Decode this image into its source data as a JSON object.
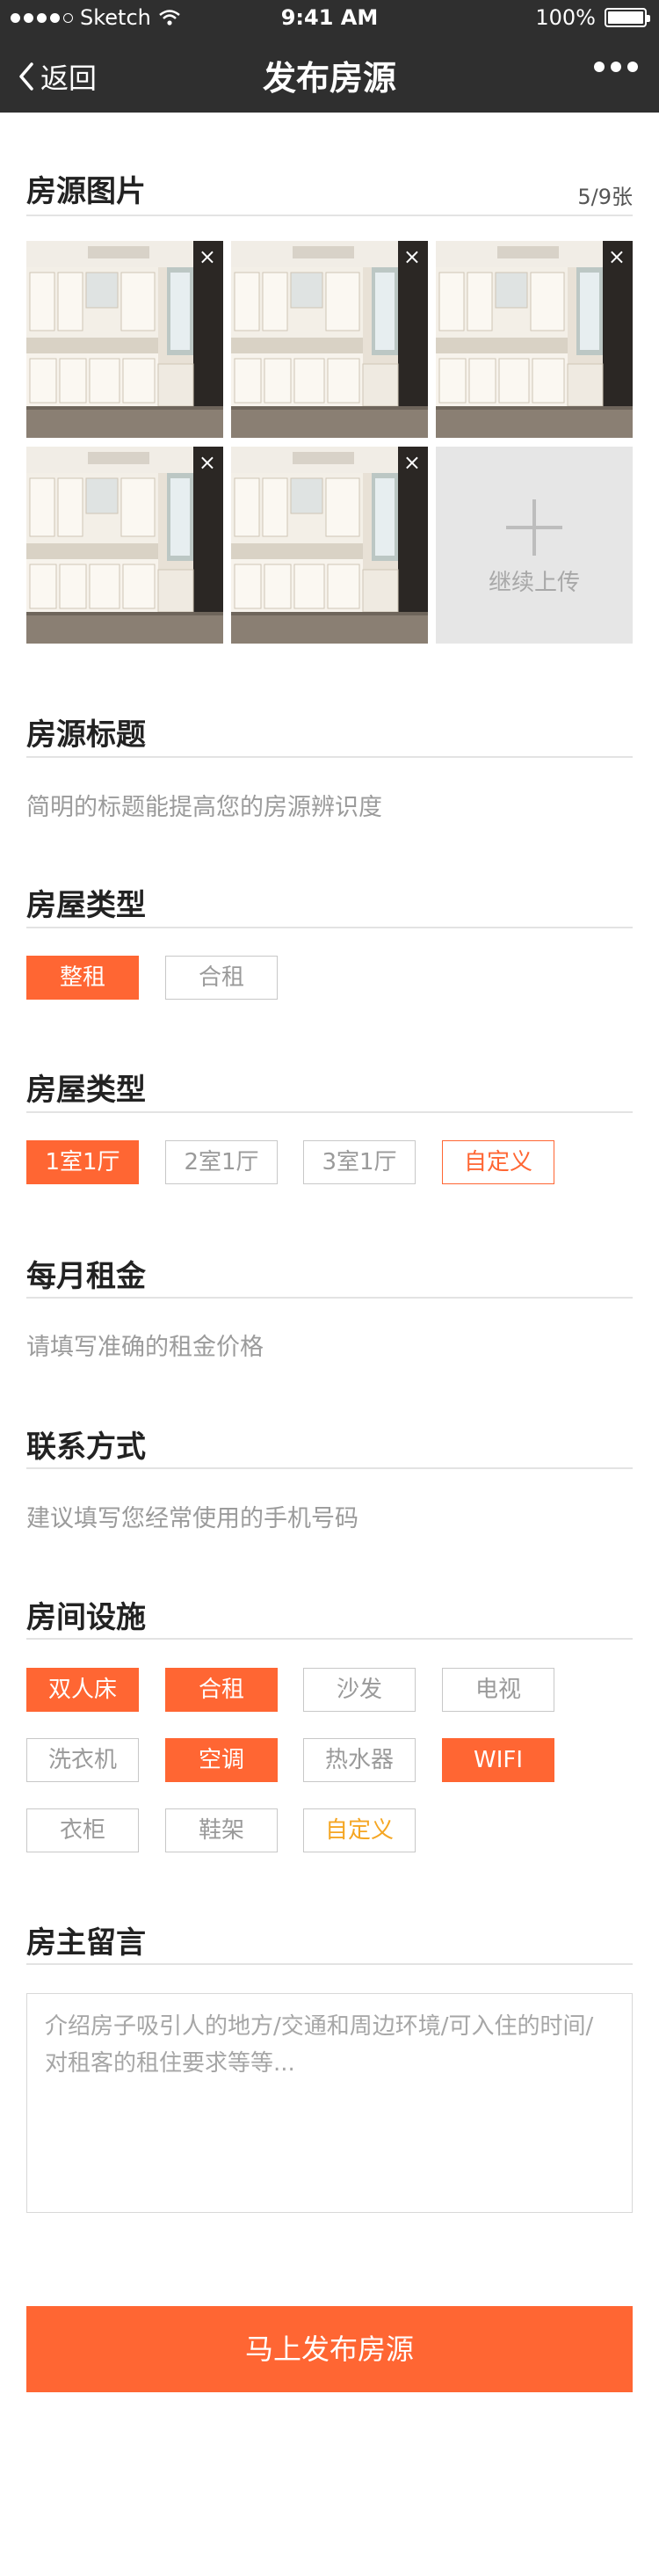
{
  "status_bar": {
    "carrier": "Sketch",
    "time": "9:41 AM",
    "battery": "100%"
  },
  "nav": {
    "back_label": "返回",
    "title": "发布房源",
    "more_icon": "more-icon"
  },
  "photos": {
    "title": "房源图片",
    "count": "5/9张",
    "add_label": "继续上传",
    "remove_icon": "×"
  },
  "listing_title": {
    "title": "房源标题",
    "placeholder": "简明的标题能提高您的房源辨识度"
  },
  "rent_type": {
    "title": "房屋类型",
    "options": [
      "整租",
      "合租"
    ],
    "selected": "整租"
  },
  "layout_type": {
    "title": "房屋类型",
    "options": [
      "1室1厅",
      "2室1厅",
      "3室1厅",
      "自定义"
    ],
    "selected": "1室1厅"
  },
  "monthly_rent": {
    "title": "每月租金",
    "placeholder": "请填写准确的租金价格"
  },
  "contact": {
    "title": "联系方式",
    "placeholder": "建议填写您经常使用的手机号码"
  },
  "facilities": {
    "title": "房间设施",
    "options": [
      "双人床",
      "合租",
      "沙发",
      "电视",
      "洗衣机",
      "空调",
      "热水器",
      "WIFI",
      "衣柜",
      "鞋架",
      "自定义"
    ],
    "selected": [
      "双人床",
      "合租",
      "空调",
      "WIFI"
    ]
  },
  "landlord_note": {
    "title": "房主留言",
    "placeholder": "介绍房子吸引人的地方/交通和周边环境/可入住的时间/对租客的租住要求等等..."
  },
  "submit_label": "马上发布房源",
  "colors": {
    "accent": "#ff6633",
    "nav_bg": "#2f2f2f",
    "custom_tag": "#f5a623"
  }
}
